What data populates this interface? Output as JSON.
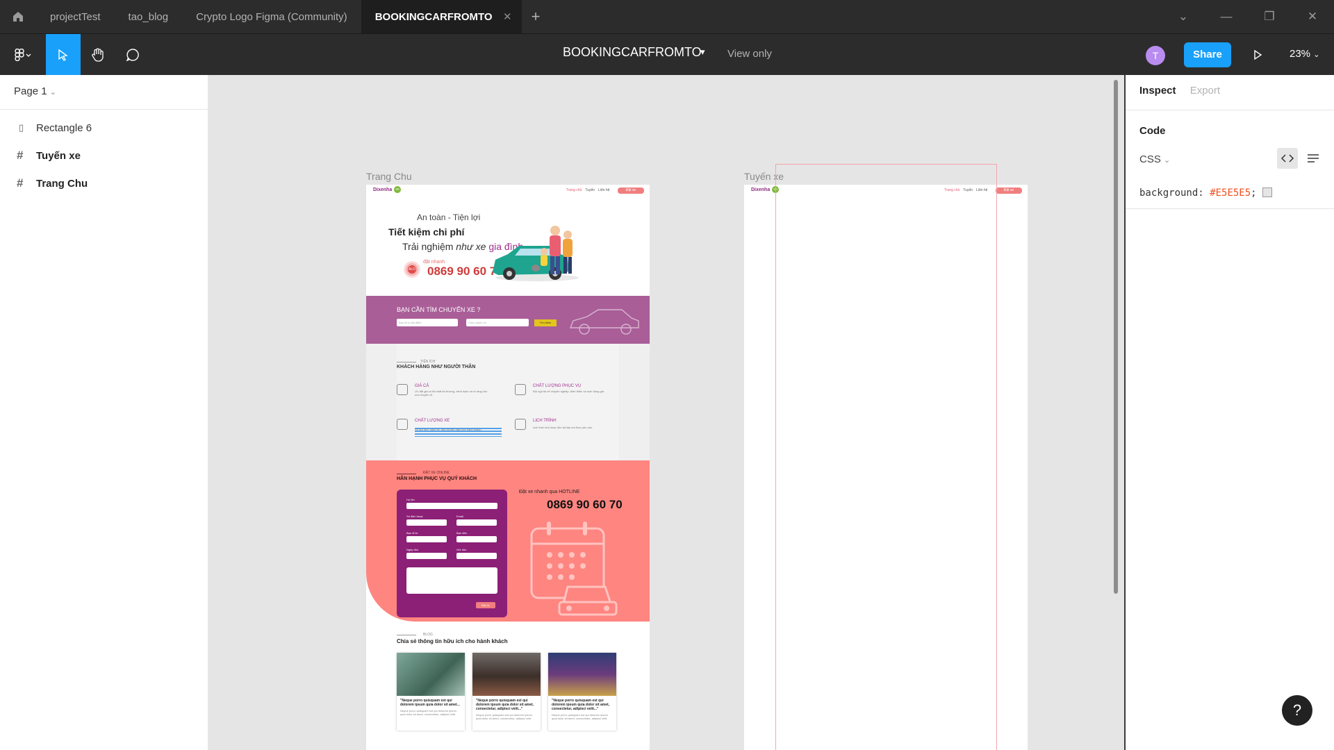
{
  "tabs": {
    "items": [
      {
        "label": "projectTest"
      },
      {
        "label": "tao_blog"
      },
      {
        "label": "Crypto Logo Figma (Community)"
      },
      {
        "label": "BOOKINGCARFROMTO"
      }
    ],
    "active_index": 3
  },
  "toolbar": {
    "doc_title": "BOOKINGCARFROMTO",
    "view_mode": "View only",
    "avatar_initial": "T",
    "share_label": "Share",
    "zoom": "23%"
  },
  "left_panel": {
    "page": "Page 1",
    "layers": [
      {
        "name": "Rectangle 6",
        "icon": "rectangle-icon"
      },
      {
        "name": "Tuyến xe",
        "icon": "frame-icon"
      },
      {
        "name": "Trang Chu",
        "icon": "frame-icon"
      }
    ]
  },
  "canvas": {
    "frames": [
      {
        "label": "Trang Chu"
      },
      {
        "label": "Tuyến xe"
      }
    ],
    "site": {
      "logo": "Dixenha",
      "logo_badge": "vn",
      "nav_links": [
        "Trang chủ",
        "Tuyến",
        "Liên hệ"
      ],
      "nav_cta": "Đặt xe",
      "hero_line1": "An toàn - Tiện lợi",
      "hero_line2": "Tiết kiệm chi phí",
      "hero_line3_a": "Trải nghiệm ",
      "hero_line3_b": "như xe ",
      "hero_line3_c": "gia đình",
      "hero_small": "đặt nhanh",
      "alo": "ALO",
      "hero_phone": "0869 90 60 70",
      "search_title": "BẠN CẦN TÌM CHUYẾN XE ?",
      "search_from": "Bạn đi từ địa điểm",
      "search_to": "Chọn tuyến xe",
      "search_btn": "Tìm kiếm",
      "features_kicker": "TIỆN ÍCH",
      "features_title": "KHÁCH HÀNG NHƯ NGƯỜI THÂN",
      "features": [
        {
          "title": "GIÁ CẢ",
          "text": "Ưu đãi giá cả tốt nhất thị trường, minh bạch và rõ ràng cho mọi chuyến đi."
        },
        {
          "title": "CHẤT LƯỢNG PHỤC VỤ",
          "text": "Đội ngũ tài xế chuyên nghiệp, thân thiện và luôn đúng giờ."
        },
        {
          "title": "CHẤT LƯỢNG XE",
          "text": "Xe đời mới, sạch sẽ, đầy đủ tiện nghi cho hành khách."
        },
        {
          "title": "LỊCH TRÌNH",
          "text": "Lịch trình linh hoạt, đón trả tận nơi theo yêu cầu."
        }
      ],
      "booking_kicker": "ĐẶT XE ONLINE",
      "booking_title": "HÂN HẠNH PHỤC VỤ QUÝ KHÁCH",
      "booking_fields": [
        "Họ tên",
        "Số điện thoại",
        "Email",
        "Bạn đi từ",
        "Bạn đến",
        "Ngày đón",
        "Giờ đón"
      ],
      "booking_submit": "Đặt xe",
      "hotline_kicker": "Đặt xe nhanh qua HOTLINE",
      "hotline_phone": "0869 90 60 70",
      "blog_kicker": "BLOG",
      "blog_title": "Chia sẻ thông tin hữu ích cho hành khách",
      "blog_cards": [
        {
          "quote": "\"Neque porro quisquam est qui dolorem ipsum quia dolor sit amet...",
          "body": "Neque porro quisquam est qui dolorem ipsum quia dolor sit amet, consectetur, adipisci velit."
        },
        {
          "quote": "\"Neque porro quisquam est qui dolorem ipsum quia dolor sit amet, consectetur, adipisci velit...\"",
          "body": "Neque porro quisquam est qui dolorem ipsum quia dolor sit amet, consectetur, adipisci velit."
        },
        {
          "quote": "\"Neque porro quisquam est qui dolorem ipsum quia dolor sit amet, consectetur, adipisci velit...\"",
          "body": "Neque porro quisquam est qui dolorem ipsum quia dolor sit amet, consectetur, adipisci velit."
        }
      ]
    }
  },
  "right_panel": {
    "tab_inspect": "Inspect",
    "tab_export": "Export",
    "section": "Code",
    "lang": "CSS",
    "prop_name": "background: ",
    "prop_value": "#E5E5E5",
    "prop_end": ";"
  },
  "colors": {
    "figma_blue": "#18A0FB",
    "canvas_bg": "#E5E5E5",
    "brand_purple": "#A95E98",
    "booking_coral": "#FE8580"
  }
}
